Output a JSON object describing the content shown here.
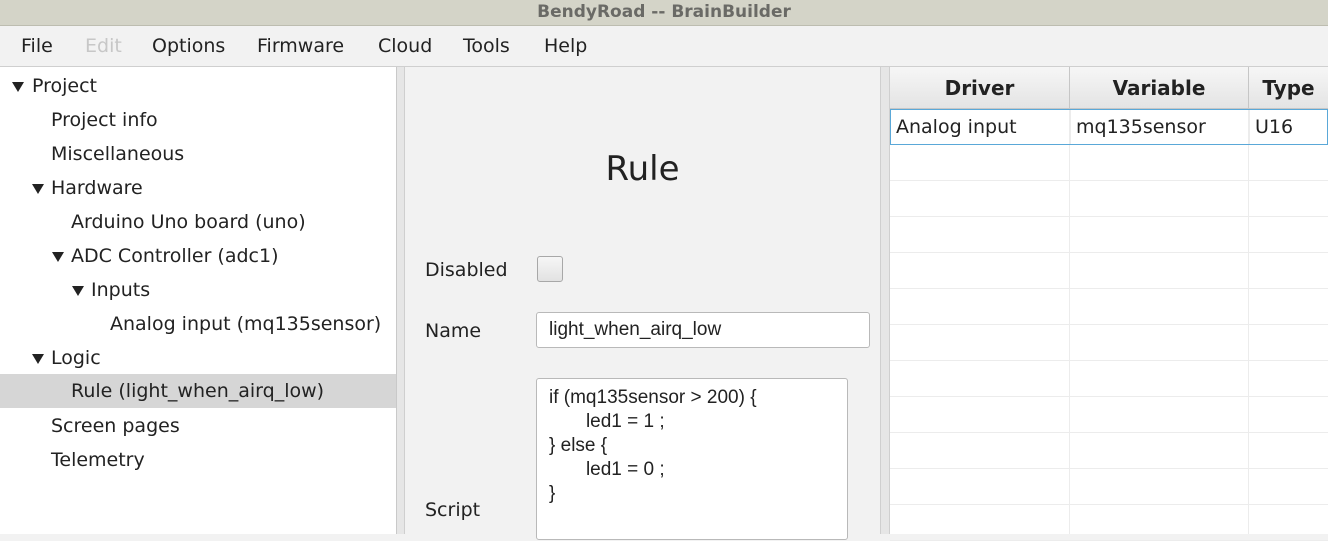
{
  "window": {
    "title": "BendyRoad -- BrainBuilder"
  },
  "menu": [
    {
      "label": "File",
      "enabled": true
    },
    {
      "label": "Edit",
      "enabled": false
    },
    {
      "label": "Options",
      "enabled": true
    },
    {
      "label": "Firmware",
      "enabled": true
    },
    {
      "label": "Cloud",
      "enabled": true
    },
    {
      "label": "Tools",
      "enabled": true
    },
    {
      "label": "Help",
      "enabled": true
    }
  ],
  "tree": {
    "items": [
      {
        "label": "Project",
        "expanded": true
      },
      {
        "label": "Project info"
      },
      {
        "label": "Miscellaneous"
      },
      {
        "label": "Hardware",
        "expanded": true
      },
      {
        "label": "Arduino Uno board (uno)"
      },
      {
        "label": "ADC Controller (adc1)",
        "expanded": true
      },
      {
        "label": "Inputs",
        "expanded": true
      },
      {
        "label": "Analog input (mq135sensor)"
      },
      {
        "label": "Logic",
        "expanded": true
      },
      {
        "label": "Rule (light_when_airq_low)",
        "selected": true
      },
      {
        "label": "Screen pages"
      },
      {
        "label": "Telemetry"
      }
    ]
  },
  "form": {
    "title": "Rule",
    "disabled_label": "Disabled",
    "disabled_checked": false,
    "name_label": "Name",
    "name_value": "light_when_airq_low",
    "script_label": "Script",
    "script_lines": [
      "if (mq135sensor > 200) {",
      "       led1 = 1 ;",
      "} else {",
      "       led1 = 0 ;",
      "}"
    ]
  },
  "table": {
    "columns": [
      "Driver",
      "Variable",
      "Type"
    ],
    "rows": [
      [
        "Analog input",
        "mq135sensor",
        "U16"
      ]
    ]
  }
}
